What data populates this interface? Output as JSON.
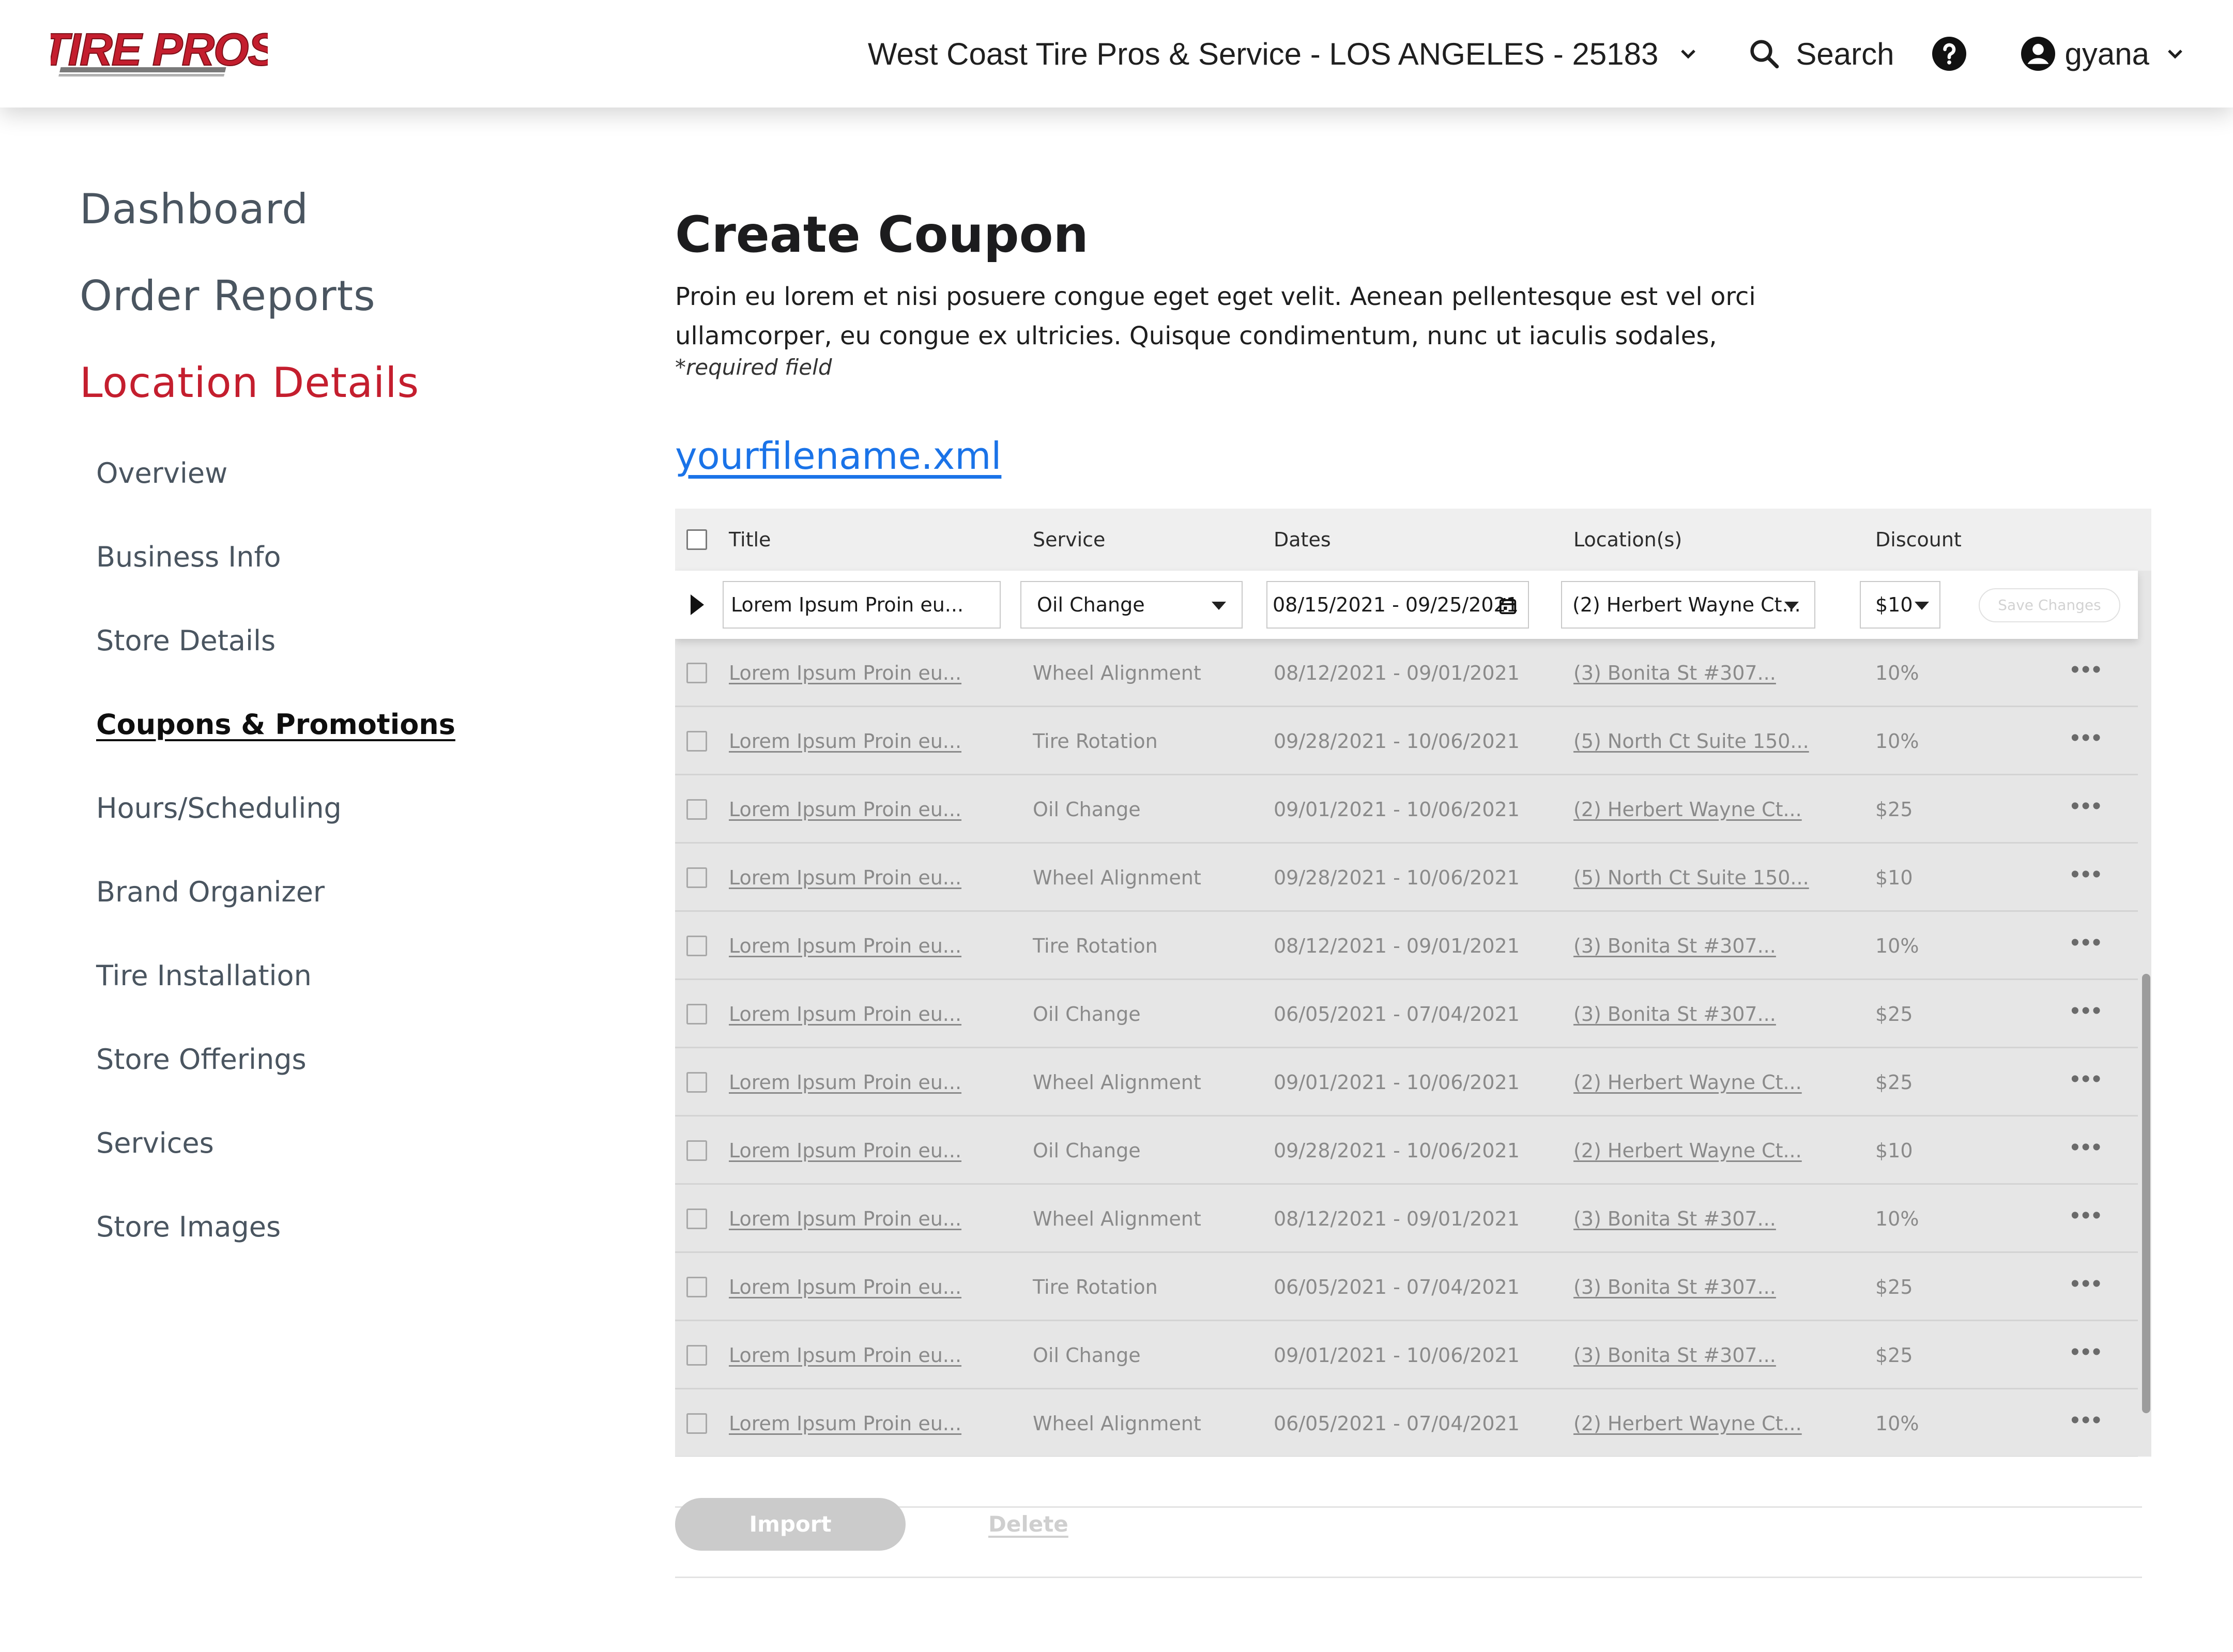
{
  "header": {
    "logo_text": "TIRE PROS",
    "store_name": "West Coast Tire Pros & Service - LOS ANGELES - 25183",
    "search_label": "Search",
    "username": "gyana"
  },
  "sidebar": {
    "main": [
      "Dashboard",
      "Order Reports",
      "Location Details"
    ],
    "sub": [
      "Overview",
      "Business Info",
      "Store Details",
      "Coupons & Promotions",
      "Hours/Scheduling",
      "Brand Organizer",
      "Tire Installation",
      "Store Offerings",
      "Services",
      "Store Images"
    ],
    "active_main": "Location Details",
    "active_sub": "Coupons & Promotions"
  },
  "main": {
    "title": "Create Coupon",
    "description": "Proin eu lorem et nisi posuere congue eget eget velit. Aenean pellentesque est vel orci ullamcorper, eu congue ex ultricies. Quisque condimentum, nunc ut iaculis sodales,",
    "required_note": "*required field",
    "file_link": "yourfilename.xml"
  },
  "table": {
    "headers": {
      "title": "Title",
      "service": "Service",
      "dates": "Dates",
      "locations": "Location(s)",
      "discount": "Discount"
    },
    "edit_row": {
      "title": "Lorem Ipsum Proin eu...",
      "service": "Oil Change",
      "dates": "08/15/2021 - 09/25/2021",
      "location": "(2) Herbert Wayne Ct...",
      "discount": "$10",
      "save_label": "Save Changes"
    },
    "rows": [
      {
        "title": "Lorem Ipsum Proin eu...",
        "service": "Wheel Alignment",
        "dates": "08/12/2021 - 09/01/2021",
        "location": "(3) Bonita St #307...",
        "discount": "10%"
      },
      {
        "title": "Lorem Ipsum Proin eu...",
        "service": "Tire Rotation",
        "dates": "09/28/2021 - 10/06/2021",
        "location": "(5) North Ct Suite 150...",
        "discount": "10%"
      },
      {
        "title": "Lorem Ipsum Proin eu...",
        "service": "Oil Change",
        "dates": "09/01/2021 - 10/06/2021",
        "location": "(2) Herbert Wayne Ct...",
        "discount": "$25"
      },
      {
        "title": "Lorem Ipsum Proin eu...",
        "service": "Wheel Alignment",
        "dates": "09/28/2021 - 10/06/2021",
        "location": "(5) North Ct Suite 150...",
        "discount": "$10"
      },
      {
        "title": "Lorem Ipsum Proin eu...",
        "service": "Tire Rotation",
        "dates": "08/12/2021 - 09/01/2021",
        "location": "(3) Bonita St #307...",
        "discount": "10%"
      },
      {
        "title": "Lorem Ipsum Proin eu...",
        "service": "Oil Change",
        "dates": "06/05/2021 - 07/04/2021",
        "location": "(3) Bonita St #307...",
        "discount": "$25"
      },
      {
        "title": "Lorem Ipsum Proin eu...",
        "service": "Wheel Alignment",
        "dates": "09/01/2021 - 10/06/2021",
        "location": "(2) Herbert Wayne Ct...",
        "discount": "$25"
      },
      {
        "title": "Lorem Ipsum Proin eu...",
        "service": "Oil Change",
        "dates": "09/28/2021 - 10/06/2021",
        "location": "(2) Herbert Wayne Ct...",
        "discount": "$10"
      },
      {
        "title": "Lorem Ipsum Proin eu...",
        "service": "Wheel Alignment",
        "dates": "08/12/2021 - 09/01/2021",
        "location": "(3) Bonita St #307...",
        "discount": "10%"
      },
      {
        "title": "Lorem Ipsum Proin eu...",
        "service": "Tire Rotation",
        "dates": "06/05/2021 - 07/04/2021",
        "location": "(3) Bonita St #307...",
        "discount": "$25"
      },
      {
        "title": "Lorem Ipsum Proin eu...",
        "service": "Oil Change",
        "dates": "09/01/2021 - 10/06/2021",
        "location": "(3) Bonita St #307...",
        "discount": "$25"
      },
      {
        "title": "Lorem Ipsum Proin eu...",
        "service": "Wheel Alignment",
        "dates": "06/05/2021 - 07/04/2021",
        "location": "(2) Herbert Wayne Ct...",
        "discount": "10%"
      }
    ],
    "more_icon": "more-horizontal-icon"
  },
  "actions": {
    "import_label": "Import",
    "delete_label": "Delete"
  },
  "colors": {
    "brand_red": "#c41e2e",
    "link_blue": "#1a73e8",
    "text_dark": "#1c1c1e",
    "nav_gray": "#4a5560"
  }
}
